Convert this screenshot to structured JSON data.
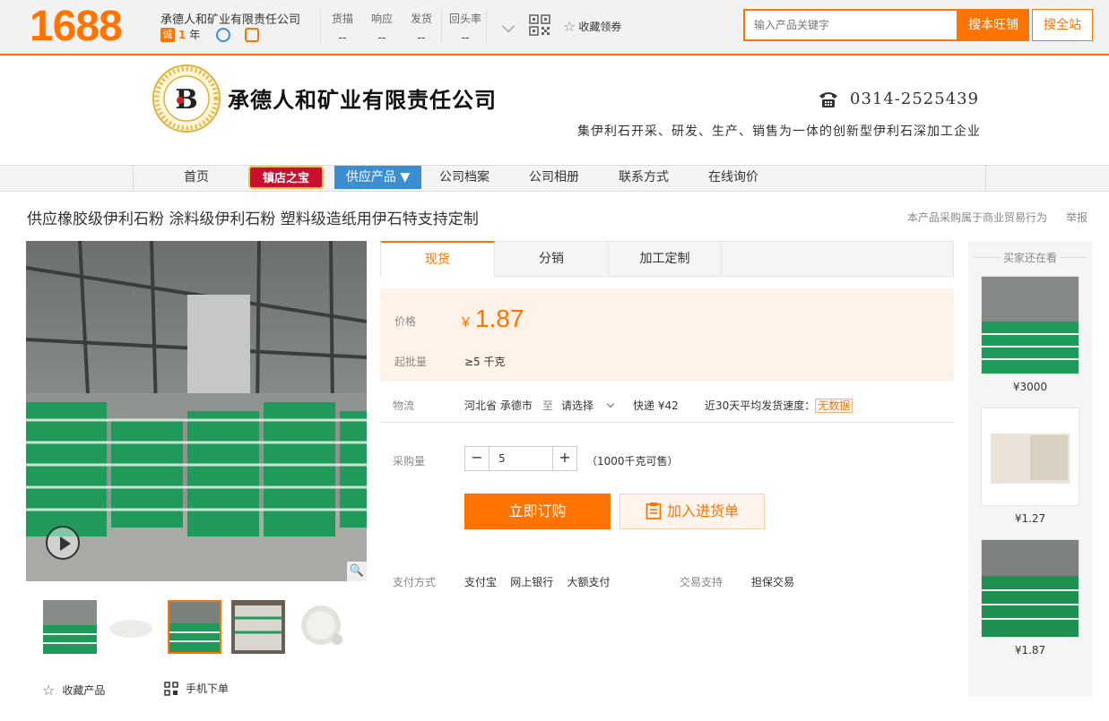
{
  "header": {
    "logo": "1688",
    "company_short": "承德人和矿业有限责任公司",
    "cheng_badge": "诚",
    "years_num": "1",
    "years_unit": "年",
    "stats": [
      {
        "label": "货描",
        "value": "--"
      },
      {
        "label": "响应",
        "value": "--"
      },
      {
        "label": "发货",
        "value": "--"
      },
      {
        "label": "回头率",
        "value": "--"
      }
    ],
    "favorite": "收藏领券",
    "search_placeholder": "输入产品关键字",
    "search_shop": "搜本旺铺",
    "search_all": "搜全站"
  },
  "banner": {
    "company_name": "承德人和矿业有限责任公司",
    "phone": "0314-2525439",
    "slogan": "集伊利石开采、研发、生产、销售为一体的创新型伊利石深加工企业"
  },
  "nav": {
    "home": "首页",
    "treasure": "镇店之宝",
    "supply": "供应产品 ▼",
    "profile": "公司档案",
    "album": "公司相册",
    "contact": "联系方式",
    "inquiry": "在线询价"
  },
  "product": {
    "title": "供应橡胶级伊利石粉 涂料级伊利石粉 塑料级造纸用伊石特支持定制",
    "trade_notice": "本产品采购属于商业贸易行为",
    "report": "举报",
    "tabs": [
      "现货",
      "分销",
      "加工定制"
    ],
    "price_label": "价格",
    "currency": "¥",
    "price": "1.87",
    "moq_label": "起批量",
    "moq": "≥5  千克",
    "logistics_label": "物流",
    "origin": "河北省 承德市",
    "to": "至",
    "dest": "请选择",
    "express": "快递 ¥42",
    "speed_label": "近30天平均发货速度：",
    "speed_value": "无数据",
    "qty_label": "采购量",
    "qty": "5",
    "stock": "（1000千克可售）",
    "buy_now": "立即订购",
    "add_cart": "加入进货单",
    "pay_label": "支付方式",
    "pay_methods": "支付宝    网上银行    大额支付",
    "trade_label": "交易支持",
    "trade_value": "担保交易",
    "fav_product": "收藏产品",
    "mobile_order": "手机下单"
  },
  "sidebar": {
    "title": "买家还在看",
    "items": [
      {
        "price": "¥3000"
      },
      {
        "price": "¥1.27"
      },
      {
        "price": "¥1.87"
      }
    ]
  },
  "colors": {
    "accent": "#ff7300",
    "nav_blue": "#3b8fd1",
    "nav_red": "#c8102e"
  }
}
